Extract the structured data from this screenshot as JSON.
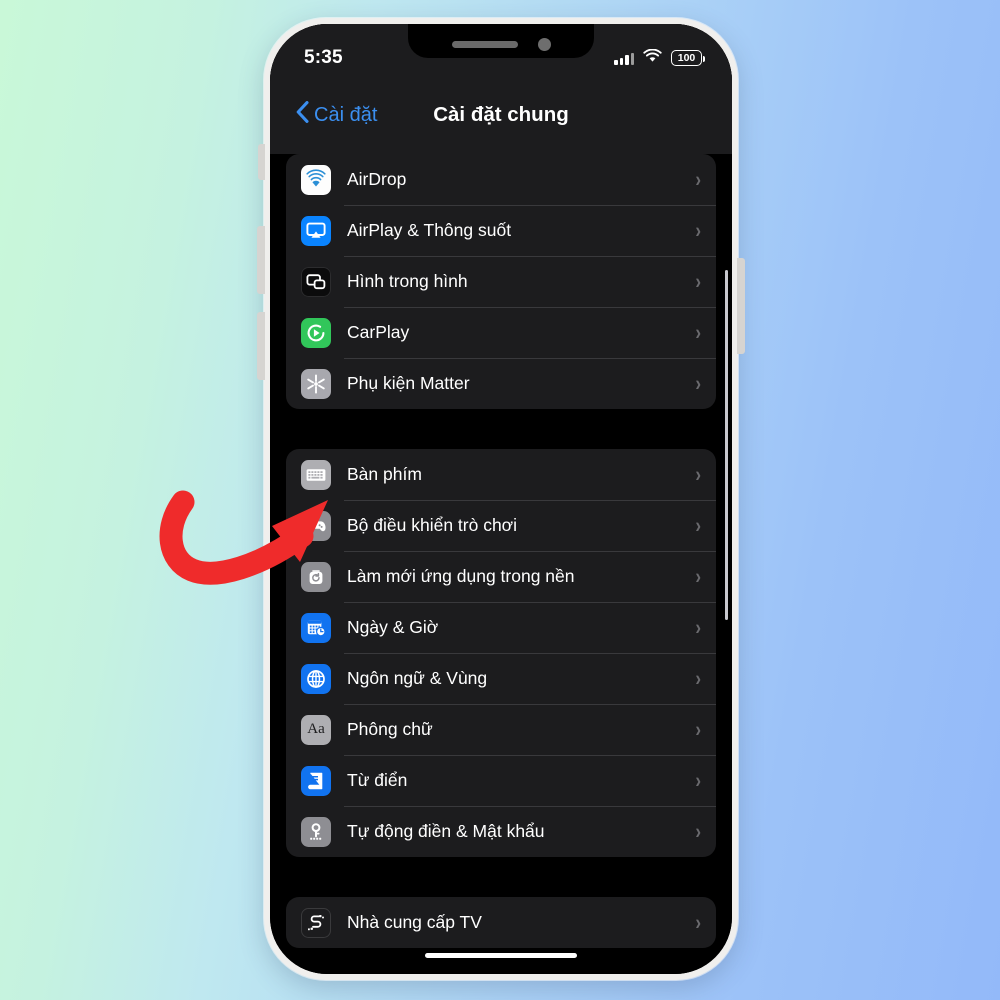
{
  "background": {
    "gradient_from": "#c9f8d8",
    "gradient_to": "#93b9f9"
  },
  "annotation": {
    "type": "curved-arrow",
    "color": "#ef2b2b",
    "points_to": "Bàn phím"
  },
  "device": {
    "frame_color": "#f0efed",
    "screen_bg": "#000000"
  },
  "status_bar": {
    "time": "5:35",
    "battery_level": "100",
    "signal_icon": "cellular-signal-icon",
    "wifi_icon": "wifi-icon",
    "battery_icon": "battery-icon"
  },
  "nav_bar": {
    "back_label": "Cài đặt",
    "back_icon": "chevron-left-icon",
    "title": "Cài đặt chung",
    "accent_color": "#3b8ff0"
  },
  "groups": [
    {
      "id": "group-connectivity",
      "rows": [
        {
          "label": "AirDrop",
          "icon": "airdrop-icon",
          "icon_class": "ic-airdrop",
          "chevron": "›"
        },
        {
          "label": "AirPlay & Thông suốt",
          "icon": "airplay-icon",
          "icon_class": "ic-airplay",
          "chevron": "›"
        },
        {
          "label": "Hình trong hình",
          "icon": "picture-in-picture-icon",
          "icon_class": "ic-pip",
          "chevron": "›"
        },
        {
          "label": "CarPlay",
          "icon": "carplay-icon",
          "icon_class": "ic-carplay",
          "chevron": "›"
        },
        {
          "label": "Phụ kiện Matter",
          "icon": "matter-icon",
          "icon_class": "ic-matter",
          "chevron": "›"
        }
      ]
    },
    {
      "id": "group-system",
      "rows": [
        {
          "label": "Bàn phím",
          "icon": "keyboard-icon",
          "icon_class": "ic-keyboard",
          "chevron": "›"
        },
        {
          "label": "Bộ điều khiển trò chơi",
          "icon": "game-controller-icon",
          "icon_class": "ic-gamepad",
          "chevron": "›"
        },
        {
          "label": "Làm mới ứng dụng trong nền",
          "icon": "background-refresh-icon",
          "icon_class": "ic-refresh",
          "chevron": "›"
        },
        {
          "label": "Ngày & Giờ",
          "icon": "date-time-icon",
          "icon_class": "ic-datetime",
          "chevron": "›"
        },
        {
          "label": "Ngôn ngữ & Vùng",
          "icon": "globe-icon",
          "icon_class": "ic-language",
          "chevron": "›"
        },
        {
          "label": "Phông chữ",
          "icon": "fonts-icon",
          "icon_class": "ic-fonts",
          "chevron": "›"
        },
        {
          "label": "Từ điển",
          "icon": "dictionary-icon",
          "icon_class": "ic-dictionary",
          "chevron": "›"
        },
        {
          "label": "Tự động điền & Mật khẩu",
          "icon": "key-icon",
          "icon_class": "ic-password",
          "chevron": "›"
        }
      ]
    },
    {
      "id": "group-media",
      "rows": [
        {
          "label": "Nhà cung cấp TV",
          "icon": "tv-provider-icon",
          "icon_class": "ic-tvprovider",
          "chevron": "›"
        }
      ]
    }
  ]
}
